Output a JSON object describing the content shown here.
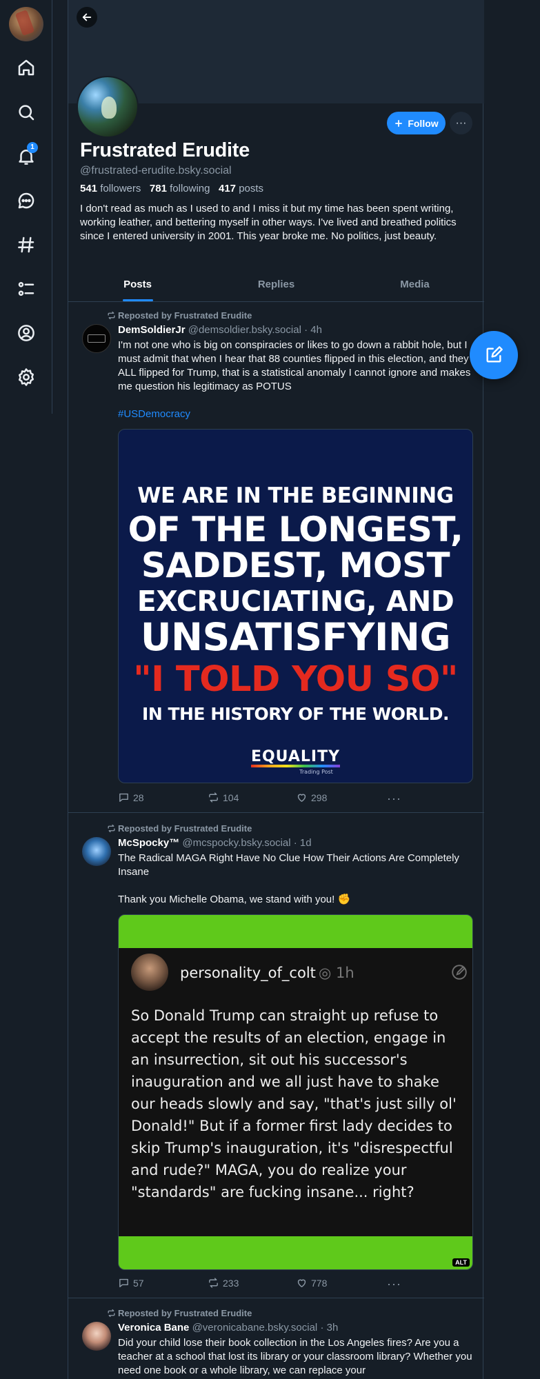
{
  "nav": {
    "notifications_badge": "1"
  },
  "profile": {
    "display_name": "Frustrated Erudite",
    "handle": "@frustrated-erudite.bsky.social",
    "followers_count": "541",
    "followers_label": "followers",
    "following_count": "781",
    "following_label": "following",
    "posts_count": "417",
    "posts_label": "posts",
    "bio": "I don't read as much as I used to and I miss it but my time has been spent writing, working leather, and bettering myself in other ways. I've lived and breathed politics since I entered university in 2001. This year broke me. No politics, just beauty.",
    "follow_label": "Follow",
    "more_label": "···"
  },
  "tabs": [
    {
      "label": "Posts",
      "active": true
    },
    {
      "label": "Replies",
      "active": false
    },
    {
      "label": "Media",
      "active": false
    }
  ],
  "posts": [
    {
      "repost_label": "Reposted by Frustrated Erudite",
      "author_name": "DemSoldierJr",
      "author_handle": "@demsoldier.bsky.social",
      "time": "· 4h",
      "text": "I'm not one who is big on conspiracies or likes to go down a rabbit hole, but I must admit that when I hear that 88 counties flipped in this election, and they ALL flipped for Trump, that is a statistical anomaly I cannot ignore and makes me question his legitimacy as POTUS",
      "hashtag": "#USDemocracy",
      "image_lines": [
        "WE ARE IN THE BEGINNING",
        "OF THE LONGEST,",
        "SADDEST, MOST",
        "EXCRUCIATING, AND",
        "UNSATISFYING",
        "\"I TOLD YOU SO\"",
        "IN THE HISTORY OF THE WORLD."
      ],
      "image_logo": "EQUALITY",
      "image_logo_sub": "Trading Post",
      "replies": "28",
      "reposts": "104",
      "likes": "298"
    },
    {
      "repost_label": "Reposted by Frustrated Erudite",
      "author_name": "McSpocky™",
      "author_handle": "@mcspocky.bsky.social",
      "time": "· 1d",
      "text_line1": "The Radical MAGA Right Have No Clue How Their Actions Are Completely Insane",
      "text_line2": "Thank you Michelle Obama, we stand with you! ✊",
      "quote_name": "personality_of_colt",
      "quote_time": "1h",
      "quote_text": "So Donald Trump can straight up refuse to accept the results of an election, engage in an insurrection, sit out his successor's inauguration and we all just have to shake our heads slowly and say, \"that's just silly ol' Donald!\" But if a former first lady decides to skip Trump's inauguration, it's \"disrespectful and rude?\" MAGA, you do realize your \"standards\" are fucking insane... right?",
      "alt_label": "ALT",
      "replies": "57",
      "reposts": "233",
      "likes": "778"
    },
    {
      "repost_label": "Reposted by Frustrated Erudite",
      "author_name": "Veronica Bane",
      "author_handle": "@veronicabane.bsky.social",
      "time": "· 3h",
      "text": "Did your child lose their book collection in the Los Angeles fires? Are you a teacher at a school that lost its library or your classroom library? Whether you need one book or a whole library, we can replace your"
    }
  ],
  "colors": {
    "accent": "#208bfe",
    "background": "#161e27",
    "border": "#2e4052"
  }
}
